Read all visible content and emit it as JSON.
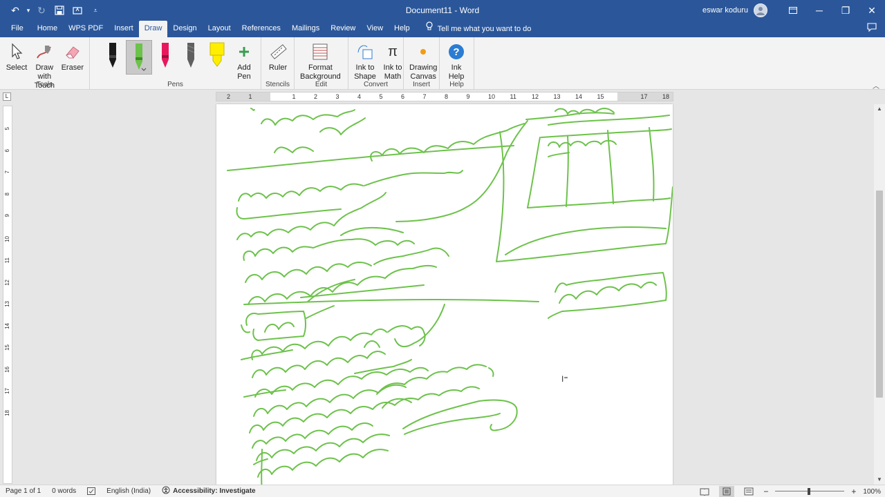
{
  "window": {
    "title": "Document11 - Word",
    "user_name": "eswar koduru"
  },
  "tabs": [
    {
      "label": "File"
    },
    {
      "label": "Home"
    },
    {
      "label": "WPS PDF"
    },
    {
      "label": "Insert"
    },
    {
      "label": "Draw"
    },
    {
      "label": "Design"
    },
    {
      "label": "Layout"
    },
    {
      "label": "References"
    },
    {
      "label": "Mailings"
    },
    {
      "label": "Review"
    },
    {
      "label": "View"
    },
    {
      "label": "Help"
    }
  ],
  "tell_me": "Tell me what you want to do",
  "ribbon": {
    "tools": {
      "label": "Tools",
      "select": "Select",
      "draw_touch_line1": "Draw with",
      "draw_touch_line2": "Touch",
      "eraser": "Eraser"
    },
    "pens": {
      "label": "Pens",
      "colors": [
        "#000000",
        "#6cc24a",
        "#e8175d",
        "#555555",
        "#ffee00"
      ],
      "add_pen_line1": "Add",
      "add_pen_line2": "Pen"
    },
    "stencils": {
      "label": "Stencils",
      "ruler": "Ruler"
    },
    "edit": {
      "label": "Edit",
      "format_bg_line1": "Format",
      "format_bg_line2": "Background"
    },
    "convert": {
      "label": "Convert",
      "ink_shape_line1": "Ink to",
      "ink_shape_line2": "Shape",
      "ink_math_line1": "Ink to",
      "ink_math_line2": "Math"
    },
    "insert": {
      "label": "Insert",
      "drawing_canvas_line1": "Drawing",
      "drawing_canvas_line2": "Canvas"
    },
    "help": {
      "label": "Help",
      "ink_help_line1": "Ink",
      "ink_help_line2": "Help"
    }
  },
  "ruler": {
    "h_numbers": [
      "2",
      "1",
      "1",
      "2",
      "3",
      "4",
      "5",
      "6",
      "7",
      "8",
      "9",
      "10",
      "11",
      "12",
      "13",
      "14",
      "15",
      "17",
      "18"
    ],
    "v_numbers": [
      "5",
      "6",
      "7",
      "8",
      "9",
      "10",
      "11",
      "12",
      "13",
      "14",
      "15",
      "16",
      "17",
      "18"
    ]
  },
  "ink_color": "#6cc24a",
  "status": {
    "page": "Page 1 of 1",
    "words": "0 words",
    "language": "English (India)",
    "accessibility": "Accessibility: Investigate",
    "zoom": "100%"
  }
}
